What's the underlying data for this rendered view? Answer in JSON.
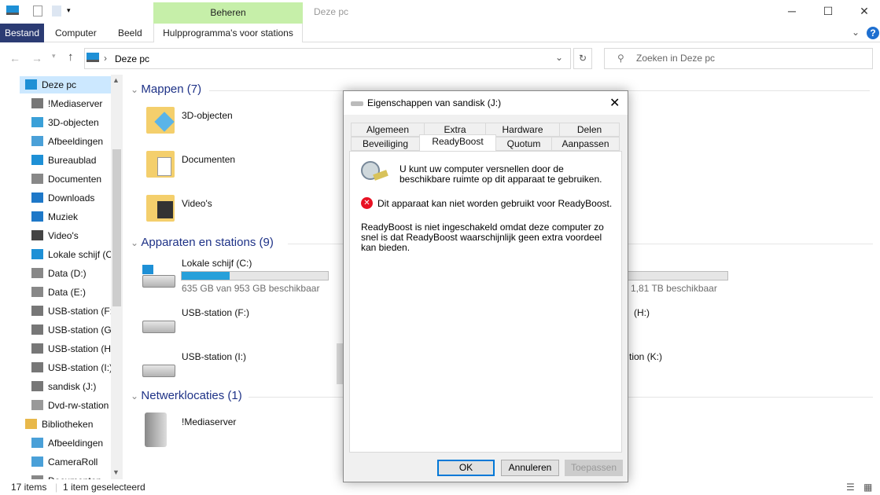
{
  "window": {
    "title": "Deze pc",
    "contextual_tab_group": "Beheren"
  },
  "ribbon": {
    "tabs": [
      "Bestand",
      "Computer",
      "Beeld",
      "Hulpprogramma's voor stations"
    ]
  },
  "address": {
    "path": "Deze pc",
    "search_placeholder": "Zoeken in Deze pc"
  },
  "nav": {
    "items": [
      "Deze pc",
      "!Mediaserver",
      "3D-objecten",
      "Afbeeldingen",
      "Bureaublad",
      "Documenten",
      "Downloads",
      "Muziek",
      "Video's",
      "Lokale schijf (C:)",
      "Data (D:)",
      "Data (E:)",
      "USB-station (F:)",
      "USB-station (G:)",
      "USB-station (H:)",
      "USB-station (I:)",
      "sandisk (J:)",
      "Dvd-rw-station",
      "Bibliotheken",
      "Afbeeldingen",
      "CameraRoll",
      "Documenten"
    ]
  },
  "content": {
    "sections": [
      "Mappen (7)",
      "Apparaten en stations (9)",
      "Netwerklocaties (1)"
    ],
    "folders": [
      "3D-objecten",
      "Documenten",
      "Video's"
    ],
    "drives": [
      {
        "name": "Lokale schijf (C:)",
        "free": "635 GB van 953 GB beschikbaar",
        "used_fraction": 0.33
      },
      {
        "name": "USB-station (F:)"
      },
      {
        "name": "USB-station (I:)"
      }
    ],
    "right_column": {
      "free_text": "1,81 TB beschikbaar",
      "drive_h": "(H:)",
      "drive_k": "tion (K:)"
    },
    "network": [
      "!Mediaserver"
    ]
  },
  "status": {
    "count": "17 items",
    "selection": "1 item geselecteerd"
  },
  "dialog": {
    "title": "Eigenschappen van sandisk (J:)",
    "tabs_row1": [
      "Algemeen",
      "Extra",
      "Hardware",
      "Delen"
    ],
    "tabs_row2": [
      "Beveiliging",
      "ReadyBoost",
      "Quotum",
      "Aanpassen"
    ],
    "active_tab": "ReadyBoost",
    "intro": "U kunt uw computer versnellen door de beschikbare ruimte op dit apparaat te gebruiken.",
    "error": "Dit apparaat kan niet worden gebruikt voor ReadyBoost.",
    "explanation": "ReadyBoost is niet ingeschakeld omdat deze computer zo snel is dat ReadyBoost waarschijnlijk geen extra voordeel kan bieden.",
    "buttons": {
      "ok": "OK",
      "cancel": "Annuleren",
      "apply": "Toepassen"
    }
  },
  "colors": {
    "accent": "#0078d7",
    "file_tab": "#2b3b73",
    "manage_tab": "#c6efa9",
    "progress": "#26a0da",
    "error": "#e81123"
  }
}
